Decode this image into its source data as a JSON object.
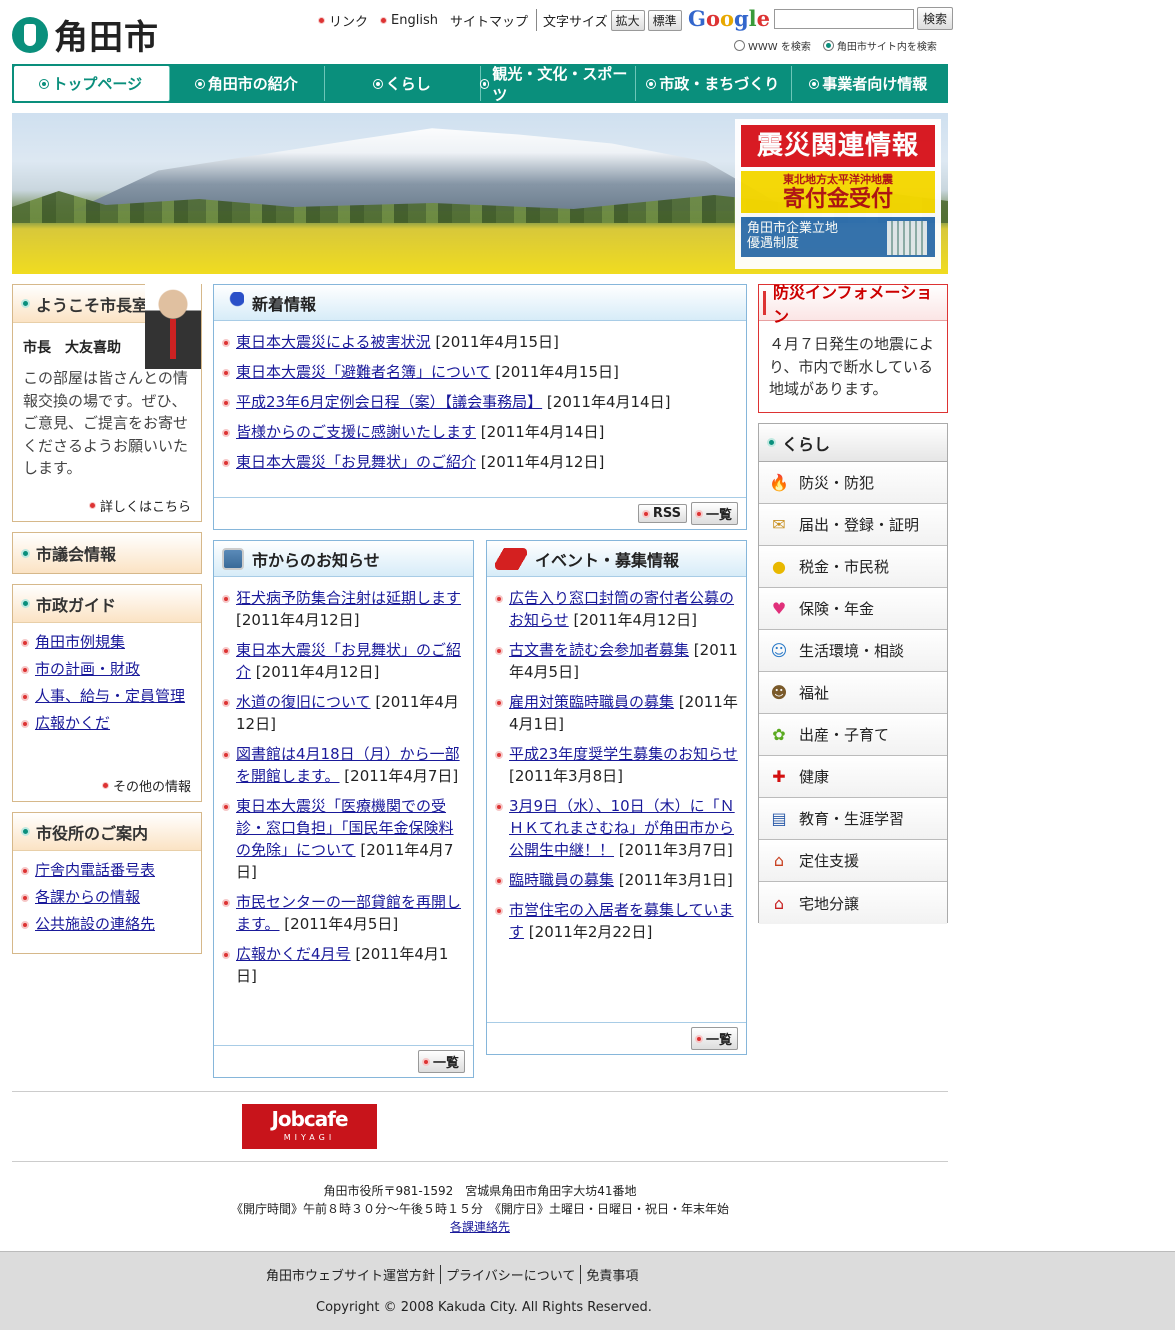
{
  "site": {
    "name": "角田市"
  },
  "toplinks": {
    "link": "リンク",
    "english": "English",
    "sitemap": "サイトマップ",
    "font_size": "文字サイズ",
    "enlarge": "拡大",
    "standard": "標準"
  },
  "google": {
    "logo": "Google",
    "search_button": "検索",
    "search_value": "",
    "radio_www": "WWW を検索",
    "radio_site": "角田市サイト内を検索"
  },
  "nav": [
    "トップページ",
    "角田市の紹介",
    "くらし",
    "観光・文化・スポーツ",
    "市政・まちづくり",
    "事業者向け情報"
  ],
  "banner": {
    "quake_title": "震災関連情報",
    "donation_sub": "東北地方太平洋沖地震",
    "donation_main": "寄付金受付",
    "enterprise": "角田市企業立地\n優遇制度"
  },
  "mayor": {
    "title": "ようこそ市長室へ",
    "name": "市長　大友喜助",
    "text": "この部屋は皆さんとの情報交換の場です。ぜひ、ご意見、ご提言をお寄せくださるようお願いいたします。",
    "more": "詳しくはこちら"
  },
  "council": {
    "title": "市議会情報"
  },
  "guide": {
    "title": "市政ガイド",
    "items": [
      "角田市例規集",
      "市の計画・財政",
      "人事、給与・定員管理",
      "広報かくだ"
    ],
    "more": "その他の情報"
  },
  "office": {
    "title": "市役所のご案内",
    "items": [
      "庁舎内電話番号表",
      "各課からの情報",
      "公共施設の連絡先"
    ]
  },
  "news": {
    "title": "新着情報",
    "items": [
      {
        "link": "東日本大震災による被害状況",
        "date": "[2011年4月15日]"
      },
      {
        "link": "東日本大震災「避難者名簿」について",
        "date": "[2011年4月15日]"
      },
      {
        "link": "平成23年6月定例会日程（案）【議会事務局】",
        "date": "[2011年4月14日]"
      },
      {
        "link": "皆様からのご支援に感謝いたします",
        "date": "[2011年4月14日]"
      },
      {
        "link": "東日本大震災「お見舞状」のご紹介",
        "date": "[2011年4月12日]"
      }
    ],
    "rss": "RSS",
    "list": "一覧"
  },
  "city": {
    "title": "市からのお知らせ",
    "items": [
      {
        "link": "狂犬病予防集合注射は延期します",
        "date": "[2011年4月12日]"
      },
      {
        "link": "東日本大震災「お見舞状」のご紹介",
        "date": "[2011年4月12日]"
      },
      {
        "link": "水道の復旧について",
        "date": "[2011年4月12日]"
      },
      {
        "link": "図書館は4月18日（月）から一部を開館します。",
        "date": "[2011年4月7日]"
      },
      {
        "link": "東日本大震災「医療機関での受診・窓口負担」「国民年金保険料の免除」について",
        "date": "[2011年4月7日]"
      },
      {
        "link": "市民センターの一部貸館を再開します。",
        "date": "[2011年4月5日]"
      },
      {
        "link": "広報かくだ4月号",
        "date": "[2011年4月1日]"
      }
    ],
    "list": "一覧"
  },
  "event": {
    "title": "イベント・募集情報",
    "items": [
      {
        "link": "広告入り窓口封筒の寄付者公募のお知らせ",
        "date": "[2011年4月12日]"
      },
      {
        "link": "古文書を読む会参加者募集",
        "date": "[2011年4月5日]"
      },
      {
        "link": "雇用対策臨時職員の募集",
        "date": "[2011年4月1日]"
      },
      {
        "link": "平成23年度奨学生募集のお知らせ",
        "date": "[2011年3月8日]"
      },
      {
        "link": "3月9日（水）、10日（木）に「ＮＨＫてれまさむね」が角田市から公開生中継！！",
        "date": "[2011年3月7日]"
      },
      {
        "link": "臨時職員の募集",
        "date": "[2011年3月1日]"
      },
      {
        "link": "市営住宅の入居者を募集しています",
        "date": "[2011年2月22日]"
      }
    ],
    "list": "一覧"
  },
  "bousai": {
    "title": "防災インフォメーション",
    "text": "４月７日発生の地震により、市内で断水している地域があります。"
  },
  "kurashi": {
    "title": "くらし",
    "items": [
      {
        "label": "防災・防犯",
        "icon": "fire-icon",
        "glyph": "🔥",
        "color": "#e04010"
      },
      {
        "label": "届出・登録・証明",
        "icon": "document-icon",
        "glyph": "✉",
        "color": "#c89020"
      },
      {
        "label": "税金・市民税",
        "icon": "coins-icon",
        "glyph": "●",
        "color": "#e8b800"
      },
      {
        "label": "保険・年金",
        "icon": "heart-icon",
        "glyph": "♥",
        "color": "#e0307a"
      },
      {
        "label": "生活環境・相談",
        "icon": "people-icon",
        "glyph": "☺",
        "color": "#2a7ac8"
      },
      {
        "label": "福祉",
        "icon": "care-icon",
        "glyph": "☻",
        "color": "#7a5a2a"
      },
      {
        "label": "出産・子育て",
        "icon": "baby-icon",
        "glyph": "✿",
        "color": "#5aaa20"
      },
      {
        "label": "健康",
        "icon": "cross-icon",
        "glyph": "✚",
        "color": "#d31010"
      },
      {
        "label": "教育・生涯学習",
        "icon": "book-icon",
        "glyph": "▤",
        "color": "#2a5aa8"
      },
      {
        "label": "定住支援",
        "icon": "house-icon",
        "glyph": "⌂",
        "color": "#c84020"
      },
      {
        "label": "宅地分譲",
        "icon": "home-icon",
        "glyph": "⌂",
        "color": "#c82020"
      }
    ]
  },
  "footer": {
    "jobcafe": "Jobcafe",
    "jobcafe_sub": "MIYAGI",
    "address": "角田市役所〒981-1592　宮城県角田市角田字大坊41番地",
    "hours": "《開庁時間》午前８時３０分～午後５時１５分　《開庁日》土曜日・日曜日・祝日・年末年始",
    "contact": "各課連絡先",
    "links": [
      "角田市ウェブサイト運営方針",
      "プライバシーについて",
      "免責事項"
    ],
    "copyright": "Copyright © 2008 Kakuda City. All Rights Reserved."
  }
}
